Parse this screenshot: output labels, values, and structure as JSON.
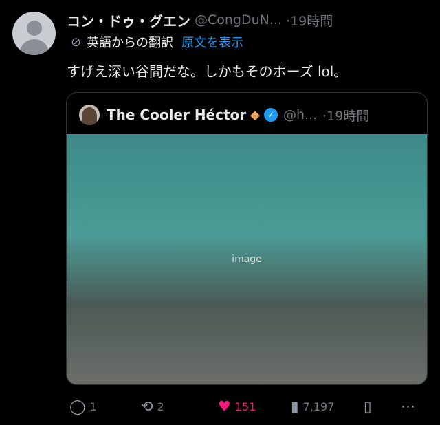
{
  "tweet": {
    "display_name": "コン・ドゥ・グエン",
    "handle": "@CongDuN...",
    "time": "·19時間",
    "translation_label": "英語からの翻訳",
    "translation_link": "原文を表示",
    "text": "すげえ深い谷間だな。しかもそのポーズ lol。"
  },
  "quoted": {
    "display_name": "The Cooler Héctor",
    "handle": "@h...",
    "time": "·19時間",
    "media_placeholder": "image"
  },
  "actions": {
    "replies": "1",
    "retweets": "2",
    "likes": "151",
    "views": "7,197"
  },
  "colors": {
    "background": "#000000",
    "link": "#1d9bf0",
    "like": "#f91880",
    "muted": "#71767b"
  },
  "icons": {
    "reply": "speech-bubble-icon",
    "retweet": "retweet-icon",
    "like": "heart-icon",
    "views": "bar-chart-icon",
    "bookmark": "bookmark-icon",
    "share": "share-icon",
    "translate": "globe-slash-icon",
    "verified": "verified-badge-icon"
  }
}
